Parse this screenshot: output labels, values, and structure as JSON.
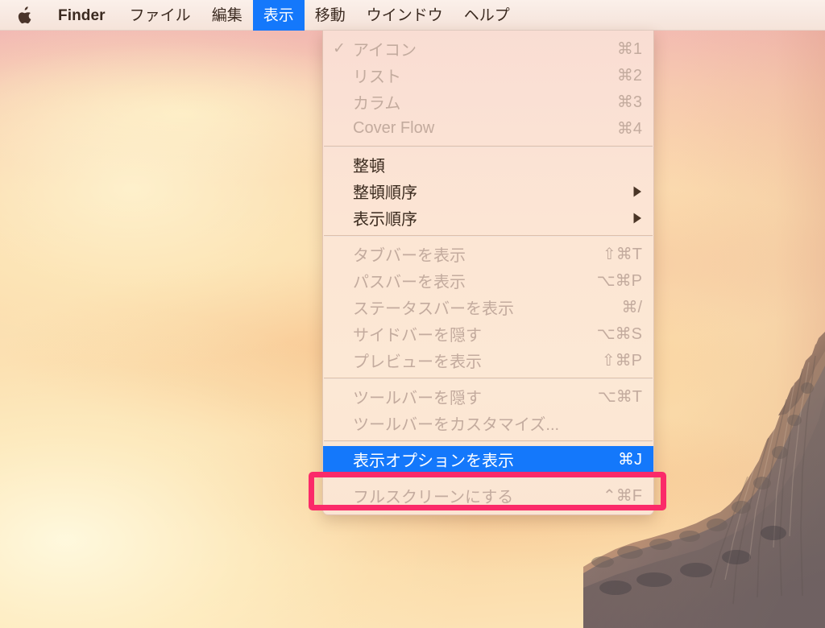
{
  "menubar": {
    "apple_icon": "apple-logo-icon",
    "items": [
      {
        "label": "Finder",
        "bold": true,
        "selected": false
      },
      {
        "label": "ファイル",
        "bold": false,
        "selected": false
      },
      {
        "label": "編集",
        "bold": false,
        "selected": false
      },
      {
        "label": "表示",
        "bold": false,
        "selected": true
      },
      {
        "label": "移動",
        "bold": false,
        "selected": false
      },
      {
        "label": "ウインドウ",
        "bold": false,
        "selected": false
      },
      {
        "label": "ヘルプ",
        "bold": false,
        "selected": false
      }
    ]
  },
  "view_menu": {
    "title": "表示",
    "groups": [
      {
        "items": [
          {
            "check": "✓",
            "label": "アイコン",
            "shortcut": "⌘1",
            "state": "disabled",
            "submenu": false
          },
          {
            "check": "",
            "label": "リスト",
            "shortcut": "⌘2",
            "state": "disabled",
            "submenu": false
          },
          {
            "check": "",
            "label": "カラム",
            "shortcut": "⌘3",
            "state": "disabled",
            "submenu": false
          },
          {
            "check": "",
            "label": "Cover Flow",
            "shortcut": "⌘4",
            "state": "disabled",
            "submenu": false
          }
        ]
      },
      {
        "items": [
          {
            "check": "",
            "label": "整頓",
            "shortcut": "",
            "state": "enabled",
            "submenu": false
          },
          {
            "check": "",
            "label": "整頓順序",
            "shortcut": "",
            "state": "enabled",
            "submenu": true
          },
          {
            "check": "",
            "label": "表示順序",
            "shortcut": "",
            "state": "enabled",
            "submenu": true
          }
        ]
      },
      {
        "items": [
          {
            "check": "",
            "label": "タブバーを表示",
            "shortcut": "⇧⌘T",
            "state": "disabled",
            "submenu": false
          },
          {
            "check": "",
            "label": "パスバーを表示",
            "shortcut": "⌥⌘P",
            "state": "disabled",
            "submenu": false
          },
          {
            "check": "",
            "label": "ステータスバーを表示",
            "shortcut": "⌘/",
            "state": "disabled",
            "submenu": false
          },
          {
            "check": "",
            "label": "サイドバーを隠す",
            "shortcut": "⌥⌘S",
            "state": "disabled",
            "submenu": false
          },
          {
            "check": "",
            "label": "プレビューを表示",
            "shortcut": "⇧⌘P",
            "state": "disabled",
            "submenu": false
          }
        ]
      },
      {
        "items": [
          {
            "check": "",
            "label": "ツールバーを隠す",
            "shortcut": "⌥⌘T",
            "state": "disabled",
            "submenu": false
          },
          {
            "check": "",
            "label": "ツールバーをカスタマイズ...",
            "shortcut": "",
            "state": "disabled",
            "submenu": false
          }
        ]
      },
      {
        "items": [
          {
            "check": "",
            "label": "表示オプションを表示",
            "shortcut": "⌘J",
            "state": "highlighted",
            "submenu": false
          }
        ]
      },
      {
        "items": [
          {
            "check": "",
            "label": "フルスクリーンにする",
            "shortcut": "⌃⌘F",
            "state": "disabled",
            "submenu": false
          }
        ]
      }
    ]
  },
  "annotation": {
    "name": "highlight-rectangle",
    "target_label": "表示オプションを表示",
    "color": "#fb2a69"
  },
  "colors": {
    "menubar_bg": "#f7e8e0",
    "menu_bg": "#fce6d4",
    "selection_blue": "#1478fb",
    "disabled_text": "#c3ab9e",
    "enabled_text": "#3a2a1e",
    "annotation_pink": "#fb2a69"
  },
  "desktop": {
    "wallpaper_name": "yosemite-sunset-wallpaper"
  }
}
